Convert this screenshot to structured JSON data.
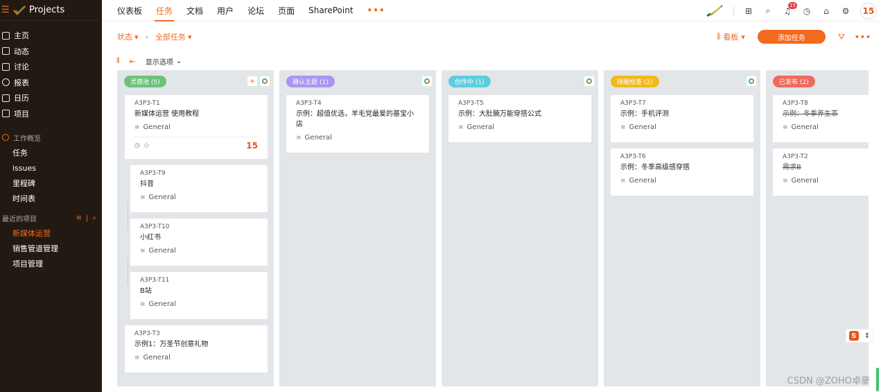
{
  "app": {
    "brand": "Projects"
  },
  "sidebar": {
    "items": [
      {
        "label": "主页",
        "icon": "home-icon"
      },
      {
        "label": "动态",
        "icon": "feed-icon"
      },
      {
        "label": "讨论",
        "icon": "discussion-icon"
      },
      {
        "label": "报表",
        "icon": "report-icon"
      },
      {
        "label": "日历",
        "icon": "calendar-icon"
      },
      {
        "label": "项目",
        "icon": "project-icon"
      }
    ],
    "work_overview": {
      "title": "工作概览",
      "items": [
        "任务",
        "issues",
        "里程碑",
        "时间表"
      ]
    },
    "recent": {
      "title": "最近的项目",
      "items": [
        "新媒体运营",
        "销售管道管理",
        "项目管理"
      ],
      "active_index": 0
    }
  },
  "topbar": {
    "tabs": [
      "仪表板",
      "任务",
      "文档",
      "用户",
      "论坛",
      "页面",
      "SharePoint"
    ],
    "active_tab": 1,
    "more": "•••",
    "notification_count": "15",
    "avatar_text": "15"
  },
  "filterbar": {
    "status": "状态",
    "all_tasks": "全部任务",
    "view": "看板",
    "add_task": "添加任务",
    "more": "•••"
  },
  "toolbar": {
    "display_options": "显示选项"
  },
  "columns": [
    {
      "label": "灵感池 (5)",
      "color": "#6cc27b",
      "has_add": true
    },
    {
      "label": "确认主题 (1)",
      "color": "#a896f2",
      "has_add": false
    },
    {
      "label": "创作中 (1)",
      "color": "#5ccde0",
      "has_add": false
    },
    {
      "label": "排版检查 (2)",
      "color": "#f2b81e",
      "has_add": false
    },
    {
      "label": "已发布 (2)",
      "color": "#ee6b5c",
      "has_add": false
    }
  ],
  "cards": {
    "c0": [
      {
        "id": "A3P3-T1",
        "title": "新媒体运营 使用教程",
        "group": "General",
        "avatar": "15"
      },
      {
        "id": "A3P3-T9",
        "title": "抖音",
        "group": "General"
      },
      {
        "id": "A3P3-T10",
        "title": "小红书",
        "group": "General"
      },
      {
        "id": "A3P3-T11",
        "title": "B站",
        "group": "General"
      },
      {
        "id": "A3P3-T3",
        "title": "示例1：万圣节创意礼物",
        "group": "General"
      }
    ],
    "c1": [
      {
        "id": "A3P3-T4",
        "title": "示例：超值优选，羊毛党最爱的基宝小店",
        "group": "General"
      }
    ],
    "c2": [
      {
        "id": "A3P3-T5",
        "title": "示例：大肚腩万能穿搭公式",
        "group": "General"
      }
    ],
    "c3": [
      {
        "id": "A3P3-T7",
        "title": "示例：手机评测",
        "group": "General"
      },
      {
        "id": "A3P3-T6",
        "title": "示例：冬季高级感穿搭",
        "group": "General"
      }
    ],
    "c4": [
      {
        "id": "A3P3-T8",
        "title": "示例：冬季养生茶",
        "group": "General"
      },
      {
        "id": "A3P3-T2",
        "title": "需求B",
        "group": "General"
      }
    ]
  },
  "watermark": "CSDN @ZOHO卓豪",
  "float_widget": {
    "label": "S"
  }
}
